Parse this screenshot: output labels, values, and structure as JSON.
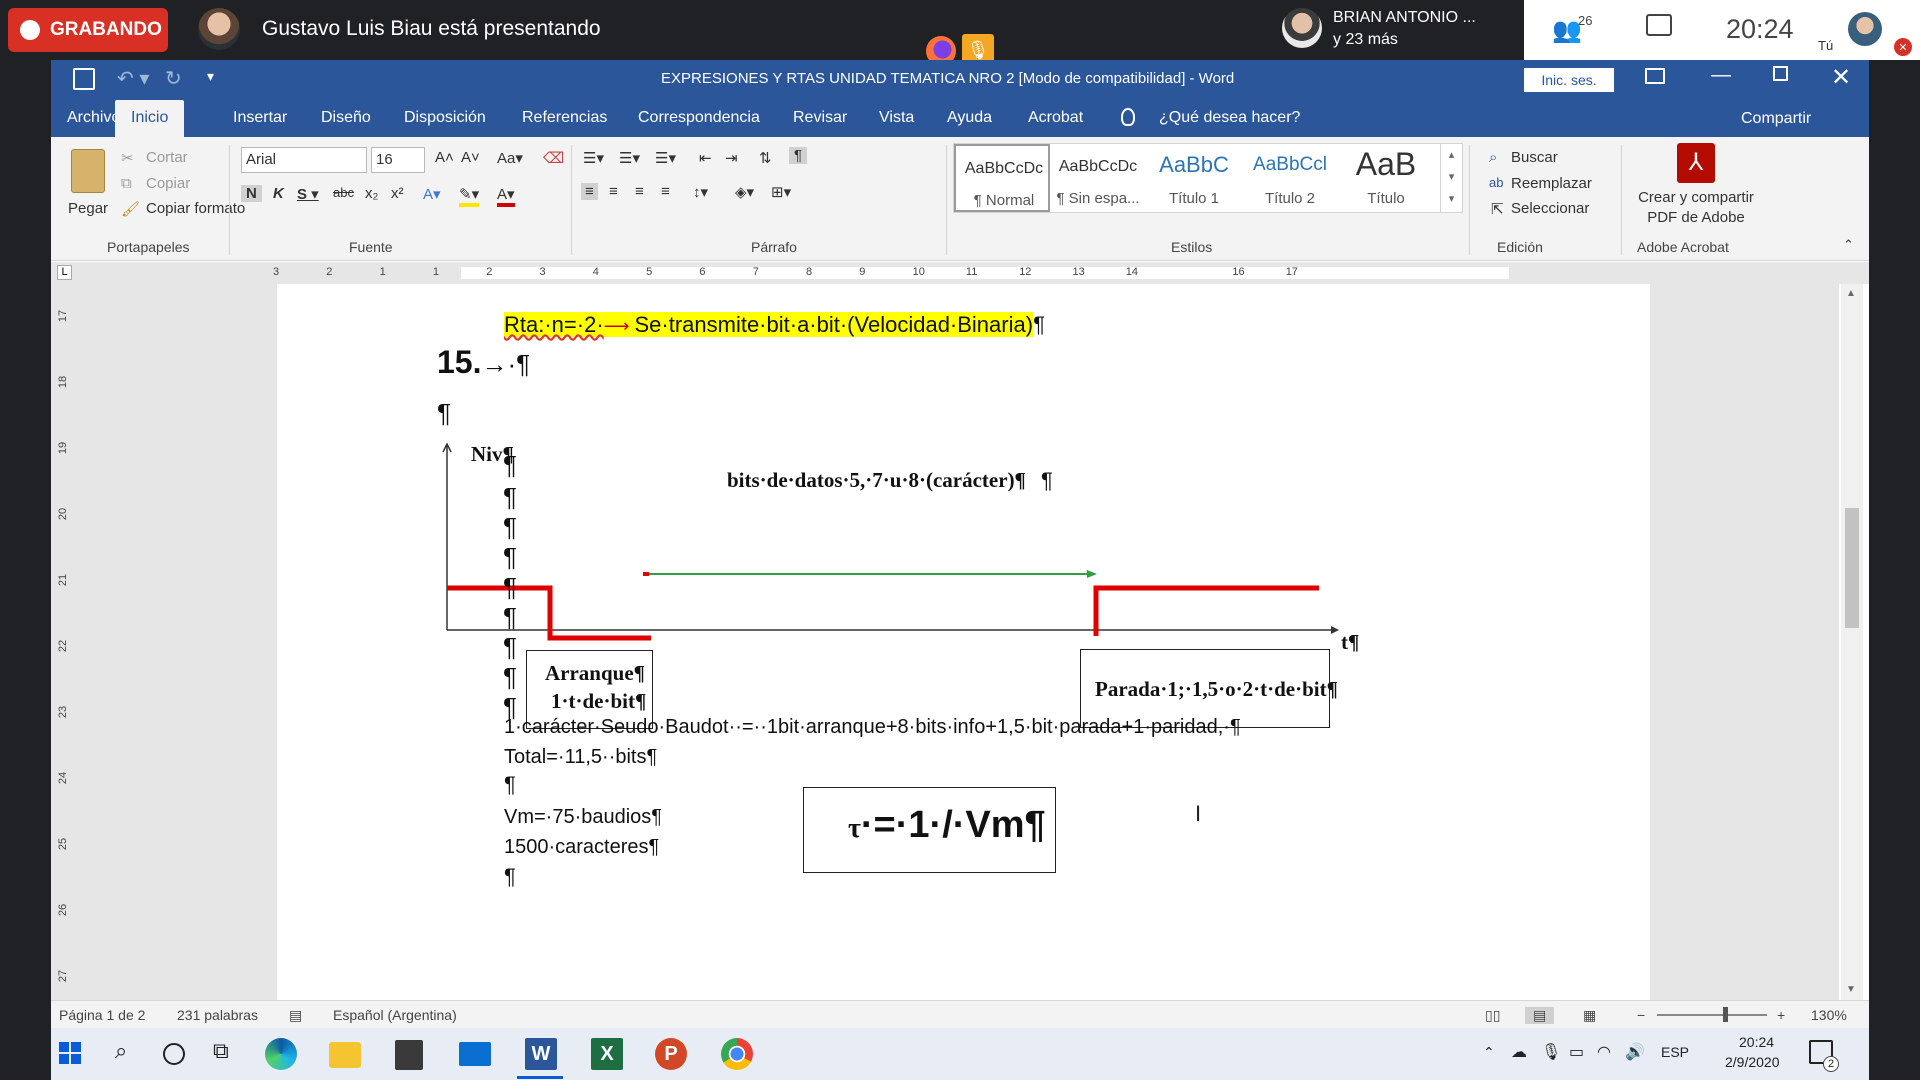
{
  "meeting": {
    "recording_label": "GRABANDO",
    "presenter_text": "Gustavo Luis Biau está presentando",
    "participant_name": "BRIAN ANTONIO ...",
    "participant_more": "y 23 más",
    "people_count": "26",
    "clock": "20:24",
    "self_label": "Tú"
  },
  "word": {
    "title": "EXPRESIONES Y RTAS  UNIDAD  TEMATICA NRO 2 [Modo de compatibilidad]  -  Word",
    "signin": "Inic. ses.",
    "tabs": [
      "Archivo",
      "Inicio",
      "Insertar",
      "Diseño",
      "Disposición",
      "Referencias",
      "Correspondencia",
      "Revisar",
      "Vista",
      "Ayuda",
      "Acrobat"
    ],
    "tell_me": "¿Qué desea hacer?",
    "share": "Compartir",
    "ribbon": {
      "paste": "Pegar",
      "cut": "Cortar",
      "copy": "Copiar",
      "format_painter": "Copiar formato",
      "clipboard_group": "Portapapeles",
      "font_name": "Arial",
      "font_size": "16",
      "font_group": "Fuente",
      "paragraph_group": "Párrafo",
      "styles": [
        {
          "sample": "AaBbCcDc",
          "name": "¶ Normal"
        },
        {
          "sample": "AaBbCcDc",
          "name": "¶ Sin espa..."
        },
        {
          "sample": "AaBbC",
          "name": "Título 1"
        },
        {
          "sample": "AaBbCcl",
          "name": "Título 2"
        },
        {
          "sample": "AaB",
          "name": "Título"
        }
      ],
      "styles_group": "Estilos",
      "find": "Buscar",
      "replace": "Reemplazar",
      "select": "Seleccionar",
      "editing_group": "Edición",
      "acrobat_btn_line1": "Crear y compartir",
      "acrobat_btn_line2": "PDF de Adobe",
      "acrobat_group": "Adobe Acrobat"
    },
    "hruler_numbers": [
      "3",
      "2",
      "1",
      "1",
      "2",
      "3",
      "4",
      "5",
      "6",
      "7",
      "8",
      "9",
      "10",
      "11",
      "12",
      "13",
      "14",
      "16",
      "17"
    ],
    "vruler_numbers": [
      "17",
      "18",
      "19",
      "20",
      "21",
      "22",
      "23",
      "24",
      "25",
      "26",
      "27"
    ],
    "status": {
      "page": "Página 1 de 2",
      "words": "231 palabras",
      "language": "Español (Argentina)",
      "zoom": "130%"
    }
  },
  "document": {
    "rta_line": "Rta:·n=·2·",
    "rta_rest": "Se·transmite·bit·a·bit·(Velocidad·Binaria)",
    "heading_15": "15.",
    "arrow": "→·",
    "pilcrow": "¶",
    "diagram": {
      "nivel": "Niv",
      "bits_label": "bits·de·datos·5,·7·u·8·(carácter)¶",
      "t_label": "t¶",
      "arranque_1": "Arranque¶",
      "arranque_2": "1·t·de·bit¶",
      "parada": "Parada·1;·1,5·o·2·t·de·bit¶"
    },
    "caracter_line": "1·carácter·Seudo·Baudot··=··1bit·arranque+8·bits·info+1,5·bit·parada+1·paridad,·¶",
    "total_line": "Total=·11,5··bits¶",
    "vm_line": "Vm=·75·baudios¶",
    "caracteres_line": "1500·caracteres¶",
    "formula_tau": "τ",
    "formula_rest": "·=·1·/·Vm¶"
  },
  "taskbar": {
    "lang": "ESP",
    "time": "20:24",
    "date": "2/9/2020",
    "notifications": "2"
  },
  "colors": {
    "word_blue": "#2b579a",
    "signal_red": "#e00000",
    "arrow_green": "#2ea043",
    "highlight": "#ffff00"
  }
}
